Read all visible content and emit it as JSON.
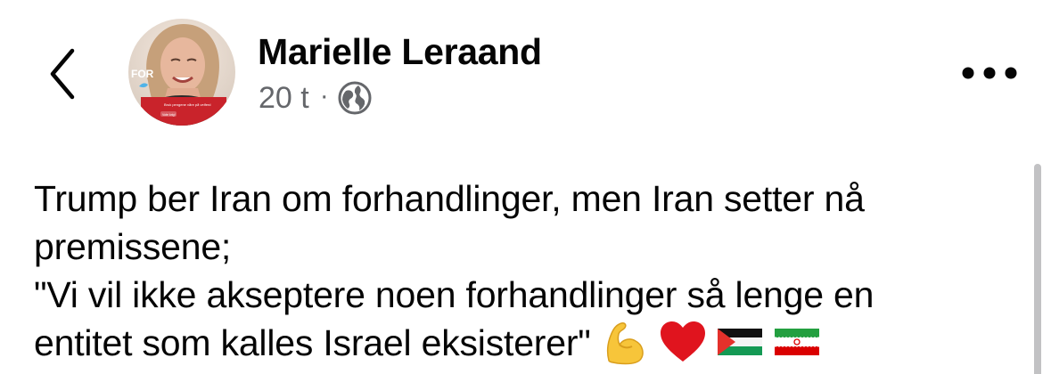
{
  "header": {
    "back_icon": "chevron-left-icon",
    "author_name": "Marielle Leraand",
    "timestamp": "20 t",
    "separator": "·",
    "audience_icon": "globe-icon",
    "more_icon": "ellipsis-icon",
    "avatar_text": {
      "logo": "FOR",
      "caption": "Bruk pengene våre på velferd",
      "button": "Vote krig!"
    }
  },
  "post": {
    "lines": [
      "Trump ber Iran om forhandlinger, men Iran setter nå",
      "premissene;",
      "\"Vi vil ikke akseptere noen forhandlinger så lenge en",
      "entitet som kalles Israel eksisterer\""
    ],
    "emojis": [
      "flexed-biceps-emoji",
      "red-heart-emoji",
      "palestine-flag-emoji",
      "iran-flag-emoji"
    ]
  },
  "colors": {
    "text": "#050505",
    "secondary_text": "#65676b",
    "scrollbar": "#c2c2c4",
    "avatar_accent": "#c9232b"
  }
}
